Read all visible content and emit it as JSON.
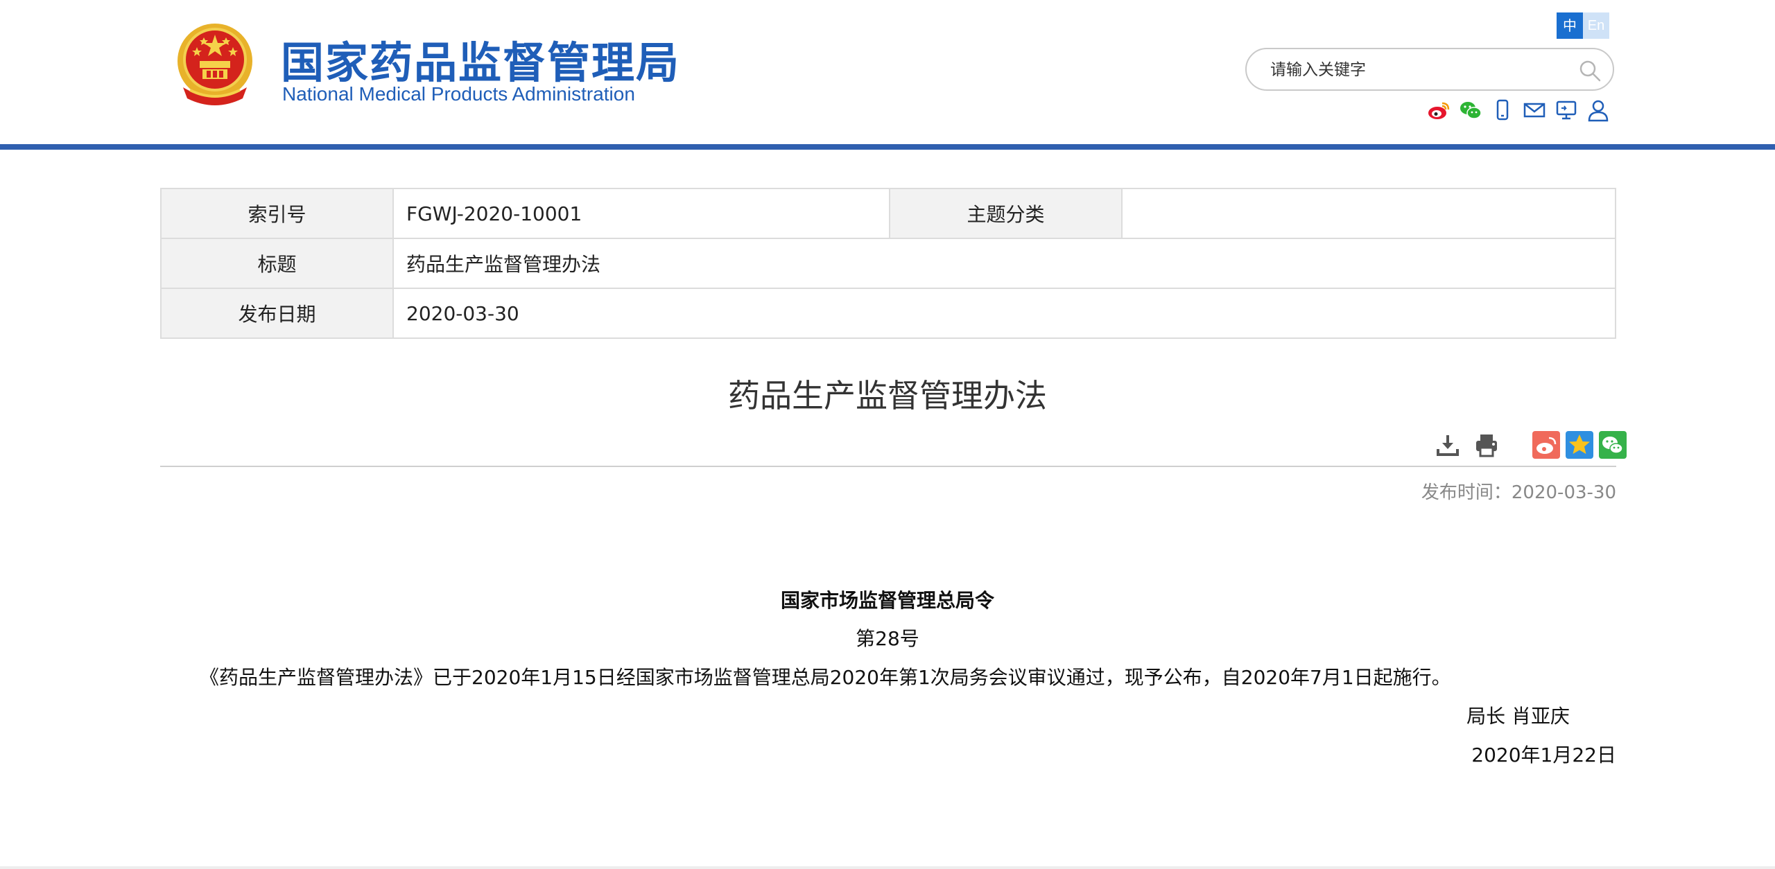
{
  "header": {
    "site_name_cn": "国家药品监督管理局",
    "site_name_en": "National Medical Products Administration",
    "lang_zh": "中",
    "lang_en": "En",
    "search_placeholder": "请输入关键字",
    "social_icons": [
      "weibo-icon",
      "wechat-icon",
      "mobile-icon",
      "mail-icon",
      "monitor-icon",
      "user-icon"
    ],
    "colors": {
      "brand": "#1f5eb8",
      "bar": "#2f5faf",
      "lang_active": "#1a6fd0"
    }
  },
  "info": {
    "index_label": "索引号",
    "index_value": "FGWJ-2020-10001",
    "topic_label": "主题分类",
    "topic_value": "",
    "title_label": "标题",
    "title_value": "药品生产监督管理办法",
    "date_label": "发布日期",
    "date_value": "2020-03-30"
  },
  "article": {
    "title": "药品生产监督管理办法",
    "tools": [
      "download-icon",
      "print-icon",
      "share-weibo-icon",
      "favorite-icon",
      "share-wechat-icon"
    ],
    "publish_time": "发布时间：2020-03-30",
    "order_title": "国家市场监督管理总局令",
    "order_no": "第28号",
    "body": "《药品生产监督管理办法》已于2020年1月15日经国家市场监督管理总局2020年第1次局务会议审议通过，现予公布，自2020年7月1日起施行。",
    "signature": "局长  肖亚庆",
    "sign_date": "2020年1月22日"
  }
}
